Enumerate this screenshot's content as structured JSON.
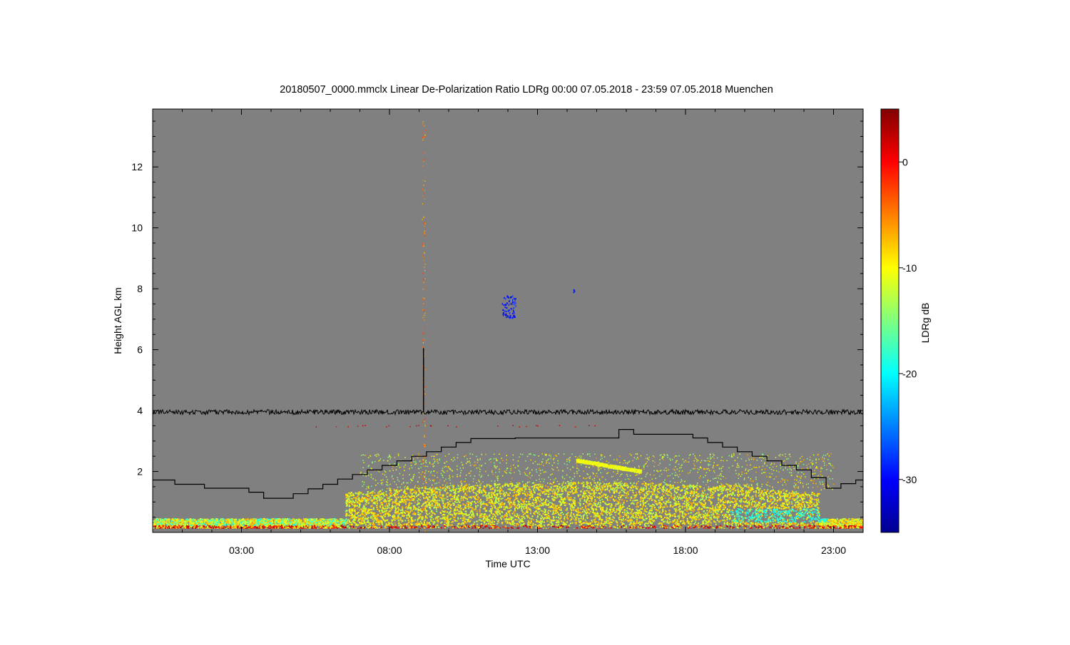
{
  "chart_data": {
    "type": "heatmap",
    "title": "20180507_0000.mmclx Linear De-Polarization Ratio LDRg   00:00 07.05.2018 - 23:59 07.05.2018 Muenchen",
    "xlabel": "Time UTC",
    "ylabel": "Height AGL km",
    "colorbar_label": "LDRg dB",
    "x_unit": "hours UTC",
    "xlim": [
      0,
      24
    ],
    "ylim": [
      0,
      13.9
    ],
    "x_ticks": [
      {
        "value": 3,
        "label": "03:00"
      },
      {
        "value": 8,
        "label": "08:00"
      },
      {
        "value": 13,
        "label": "13:00"
      },
      {
        "value": 18,
        "label": "18:00"
      },
      {
        "value": 23,
        "label": "23:00"
      }
    ],
    "y_ticks": [
      {
        "value": 2,
        "label": "2"
      },
      {
        "value": 4,
        "label": "4"
      },
      {
        "value": 6,
        "label": "6"
      },
      {
        "value": 8,
        "label": "8"
      },
      {
        "value": 10,
        "label": "10"
      },
      {
        "value": 12,
        "label": "12"
      }
    ],
    "colorbar": {
      "range": [
        -35,
        5
      ],
      "ticks": [
        {
          "value": 0,
          "label": "0"
        },
        {
          "value": -10,
          "label": "-10"
        },
        {
          "value": -20,
          "label": "-20"
        },
        {
          "value": -30,
          "label": "-30"
        }
      ],
      "colormap": "jet"
    },
    "background_color": "#808080",
    "noise_line_height_km": 3.95,
    "spike": {
      "time": 9.15,
      "height_km": 6.05
    },
    "boundary_layer_step": [
      [
        0.0,
        1.72
      ],
      [
        0.75,
        1.58
      ],
      [
        1.75,
        1.45
      ],
      [
        3.25,
        1.32
      ],
      [
        3.75,
        1.12
      ],
      [
        4.75,
        1.27
      ],
      [
        5.25,
        1.43
      ],
      [
        5.75,
        1.58
      ],
      [
        6.25,
        1.75
      ],
      [
        6.75,
        1.9
      ],
      [
        7.25,
        2.05
      ],
      [
        7.75,
        2.2
      ],
      [
        8.25,
        2.35
      ],
      [
        8.75,
        2.5
      ],
      [
        9.25,
        2.65
      ],
      [
        9.75,
        2.8
      ],
      [
        10.25,
        2.95
      ],
      [
        10.75,
        3.08
      ],
      [
        12.25,
        3.1
      ],
      [
        15.75,
        3.38
      ],
      [
        16.25,
        3.22
      ],
      [
        18.25,
        3.1
      ],
      [
        18.75,
        2.95
      ],
      [
        19.25,
        2.8
      ],
      [
        19.75,
        2.65
      ],
      [
        20.25,
        2.5
      ],
      [
        20.75,
        2.35
      ],
      [
        21.25,
        2.2
      ],
      [
        21.75,
        2.05
      ],
      [
        22.25,
        1.8
      ],
      [
        22.75,
        1.45
      ],
      [
        23.25,
        1.6
      ],
      [
        23.75,
        1.72
      ],
      [
        24.0,
        1.72
      ]
    ],
    "echo_regions": [
      {
        "name": "lower boundary layer",
        "t_start": 6.5,
        "t_end": 22.8,
        "h_low": 0.15,
        "h_high": 1.5,
        "ldr_db": -12
      },
      {
        "name": "inclined layer",
        "t_start": 14.3,
        "t_end": 16.5,
        "h_low": 2.0,
        "h_high": 2.4,
        "ldr_db": -12
      },
      {
        "name": "upper cloud",
        "t_start": 11.8,
        "t_end": 12.3,
        "h_low": 7.0,
        "h_high": 7.8,
        "ldr_db": -28
      }
    ]
  }
}
